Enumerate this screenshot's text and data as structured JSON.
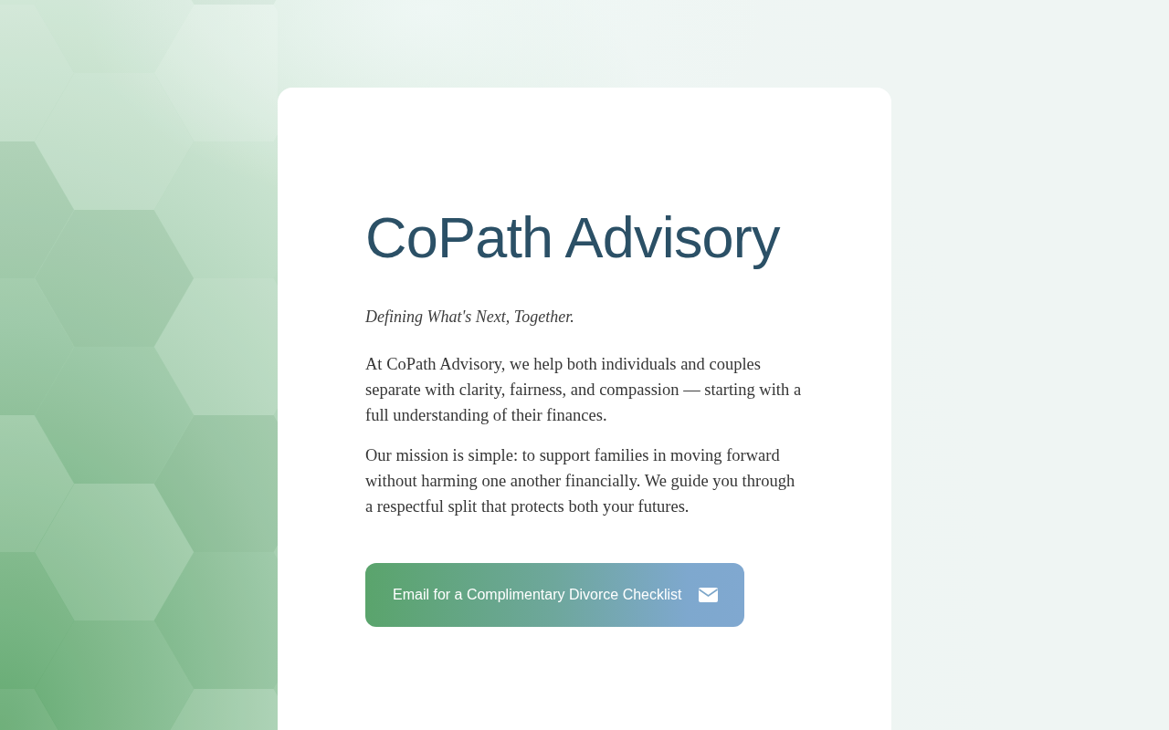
{
  "brand": {
    "title": "CoPath Advisory",
    "tagline": "Defining What's Next, Together."
  },
  "paragraphs": [
    "At CoPath Advisory, we help both individuals and couples separate with clarity, fairness, and compassion — starting with a full understanding of their finances.",
    "Our mission is simple: to support families in moving forward without harming one another financially. We guide you through a respectful split that protects both your futures."
  ],
  "cta_button": {
    "label": "Email for a Complimentary Divorce Checklist"
  }
}
